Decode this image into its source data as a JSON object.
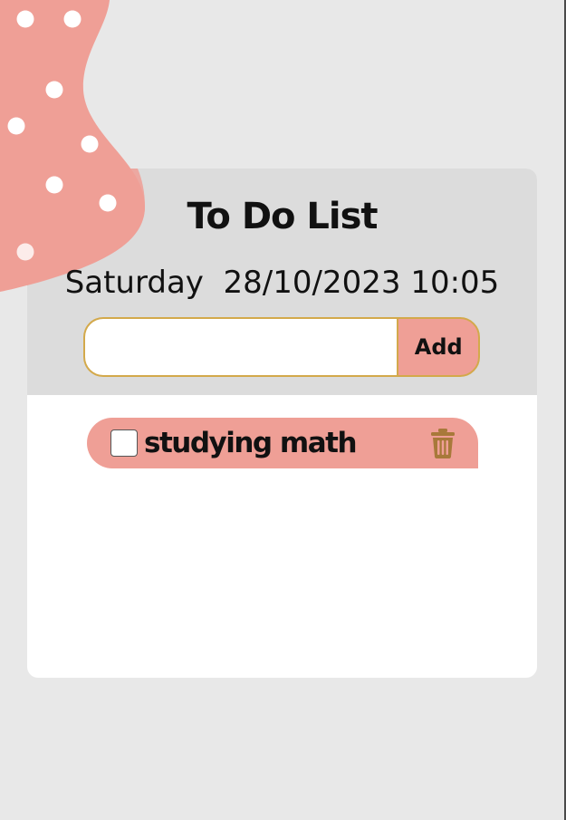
{
  "app": {
    "title": "To Do List",
    "day": "Saturday",
    "date": "28/10/2023",
    "time": "10:05"
  },
  "new_task": {
    "value": "",
    "placeholder": "",
    "add_label": "Add"
  },
  "todos": [
    {
      "text": "studying math",
      "checked": false
    }
  ],
  "icons": {
    "delete": "trash-icon"
  },
  "colors": {
    "page_background": "#e8e8e8",
    "header_background": "#dcdcdc",
    "accent_salmon": "#ef9f96",
    "input_border_gold": "#d3a94b",
    "trash_icon": "#a8793a"
  }
}
